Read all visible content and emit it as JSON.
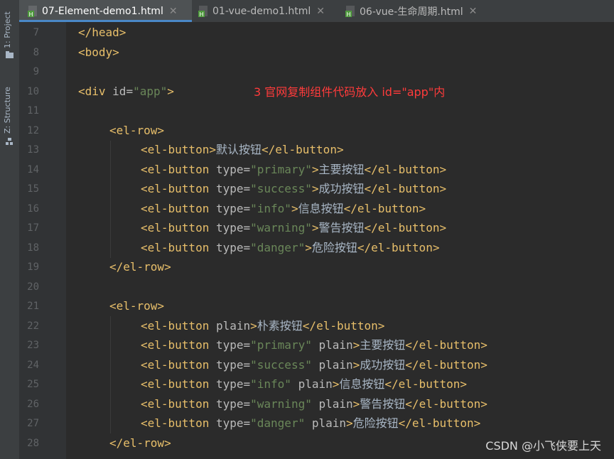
{
  "sidebar": {
    "project_label": "1: Project",
    "structure_label": "Z: Structure"
  },
  "tabs": [
    {
      "label": "07-Element-demo1.html",
      "active": true
    },
    {
      "label": "01-vue-demo1.html",
      "active": false
    },
    {
      "label": "06-vue-生命周期.html",
      "active": false
    }
  ],
  "annotation": "3 官网复制组件代码放入 id=\"app\"内",
  "watermark": "CSDN @小飞侠要上天",
  "colors": {
    "tag": "#e8bf6a",
    "attribute": "#bababa",
    "string": "#6a8759",
    "text": "#a9b7c6",
    "annotation": "#ff3b3b",
    "active_tab_underline": "#4a88c7"
  },
  "code": {
    "l7": {
      "n": "7",
      "tag": "</head>"
    },
    "l8": {
      "n": "8",
      "tag": "<body>"
    },
    "l9": {
      "n": "9"
    },
    "l10": {
      "n": "10",
      "tag_open": "<div ",
      "attr": "id=",
      "val": "\"app\"",
      "tag_close": ">"
    },
    "l11": {
      "n": "11"
    },
    "l12": {
      "n": "12",
      "tag": "<el-row>"
    },
    "l13": {
      "n": "13",
      "tag_open": "<el-button>",
      "text": "默认按钮",
      "tag_end": "</el-button>"
    },
    "l14": {
      "n": "14",
      "tag_open": "<el-button ",
      "attr": "type=",
      "val": "\"primary\"",
      "tag_close": ">",
      "text": "主要按钮",
      "tag_end": "</el-button>"
    },
    "l15": {
      "n": "15",
      "tag_open": "<el-button ",
      "attr": "type=",
      "val": "\"success\"",
      "tag_close": ">",
      "text": "成功按钮",
      "tag_end": "</el-button>"
    },
    "l16": {
      "n": "16",
      "tag_open": "<el-button ",
      "attr": "type=",
      "val": "\"info\"",
      "tag_close": ">",
      "text": "信息按钮",
      "tag_end": "</el-button>"
    },
    "l17": {
      "n": "17",
      "tag_open": "<el-button ",
      "attr": "type=",
      "val": "\"warning\"",
      "tag_close": ">",
      "text": "警告按钮",
      "tag_end": "</el-button>"
    },
    "l18": {
      "n": "18",
      "tag_open": "<el-button ",
      "attr": "type=",
      "val": "\"danger\"",
      "tag_close": ">",
      "text": "危险按钮",
      "tag_end": "</el-button>"
    },
    "l19": {
      "n": "19",
      "tag": "</el-row>"
    },
    "l20": {
      "n": "20"
    },
    "l21": {
      "n": "21",
      "tag": "<el-row>"
    },
    "l22": {
      "n": "22",
      "tag_open": "<el-button ",
      "attr2": "plain",
      "tag_close": ">",
      "text": "朴素按钮",
      "tag_end": "</el-button>"
    },
    "l23": {
      "n": "23",
      "tag_open": "<el-button ",
      "attr": "type=",
      "val": "\"primary\"",
      "attr2": " plain",
      "tag_close": ">",
      "text": "主要按钮",
      "tag_end": "</el-button>"
    },
    "l24": {
      "n": "24",
      "tag_open": "<el-button ",
      "attr": "type=",
      "val": "\"success\"",
      "attr2": " plain",
      "tag_close": ">",
      "text": "成功按钮",
      "tag_end": "</el-button>"
    },
    "l25": {
      "n": "25",
      "tag_open": "<el-button ",
      "attr": "type=",
      "val": "\"info\"",
      "attr2": " plain",
      "tag_close": ">",
      "text": "信息按钮",
      "tag_end": "</el-button>"
    },
    "l26": {
      "n": "26",
      "tag_open": "<el-button ",
      "attr": "type=",
      "val": "\"warning\"",
      "attr2": " plain",
      "tag_close": ">",
      "text": "警告按钮",
      "tag_end": "</el-button>"
    },
    "l27": {
      "n": "27",
      "tag_open": "<el-button ",
      "attr": "type=",
      "val": "\"danger\"",
      "attr2": " plain",
      "tag_close": ">",
      "text": "危险按钮",
      "tag_end": "</el-button>"
    },
    "l28": {
      "n": "28",
      "tag": "</el-row>"
    }
  }
}
